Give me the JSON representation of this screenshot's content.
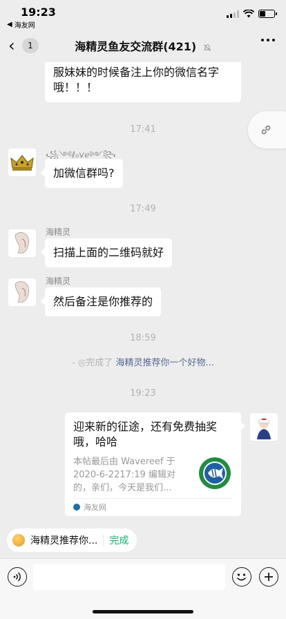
{
  "status": {
    "time": "19:23",
    "back_app": "海友网"
  },
  "nav": {
    "unread": "1",
    "title": "海精灵鱼友交流群(421)"
  },
  "messages": {
    "m1": "哦！！！一定要让朋友在加海精灵客服妹妹的时候备注上你的微信名字哦！！！",
    "ts1": "17:41",
    "m2_sender": "꧁༺ℓℴѵℯ༻꧂",
    "m2": "加微信群吗?",
    "ts2": "17:49",
    "m3_sender": "海精灵",
    "m3": "扫描上面的二维码就好",
    "m4_sender": "海精灵",
    "m4": "然后备注是你推荐的",
    "ts3": "18:59",
    "system_prefix": "- ◎完成了",
    "system_link": "海精灵推荐你一个好物...",
    "ts4": "19:23"
  },
  "card": {
    "title": "迎来新的征途，还有免费抽奖哦，哈哈",
    "desc": "本帖最后由 Wavereef 于 2020-6-2217:19 编辑对的，亲们，今天是我们...",
    "source": "海友网"
  },
  "pin": {
    "text": "海精灵推荐你...",
    "done": "完成"
  },
  "icons": [
    "back-arrow-icon",
    "mute-icon",
    "more-icon",
    "link-icon",
    "voice-icon",
    "emoji-icon",
    "plus-icon"
  ],
  "colors": {
    "accent_green": "#07c160",
    "link_blue": "#576b95",
    "background": "#ededed"
  }
}
